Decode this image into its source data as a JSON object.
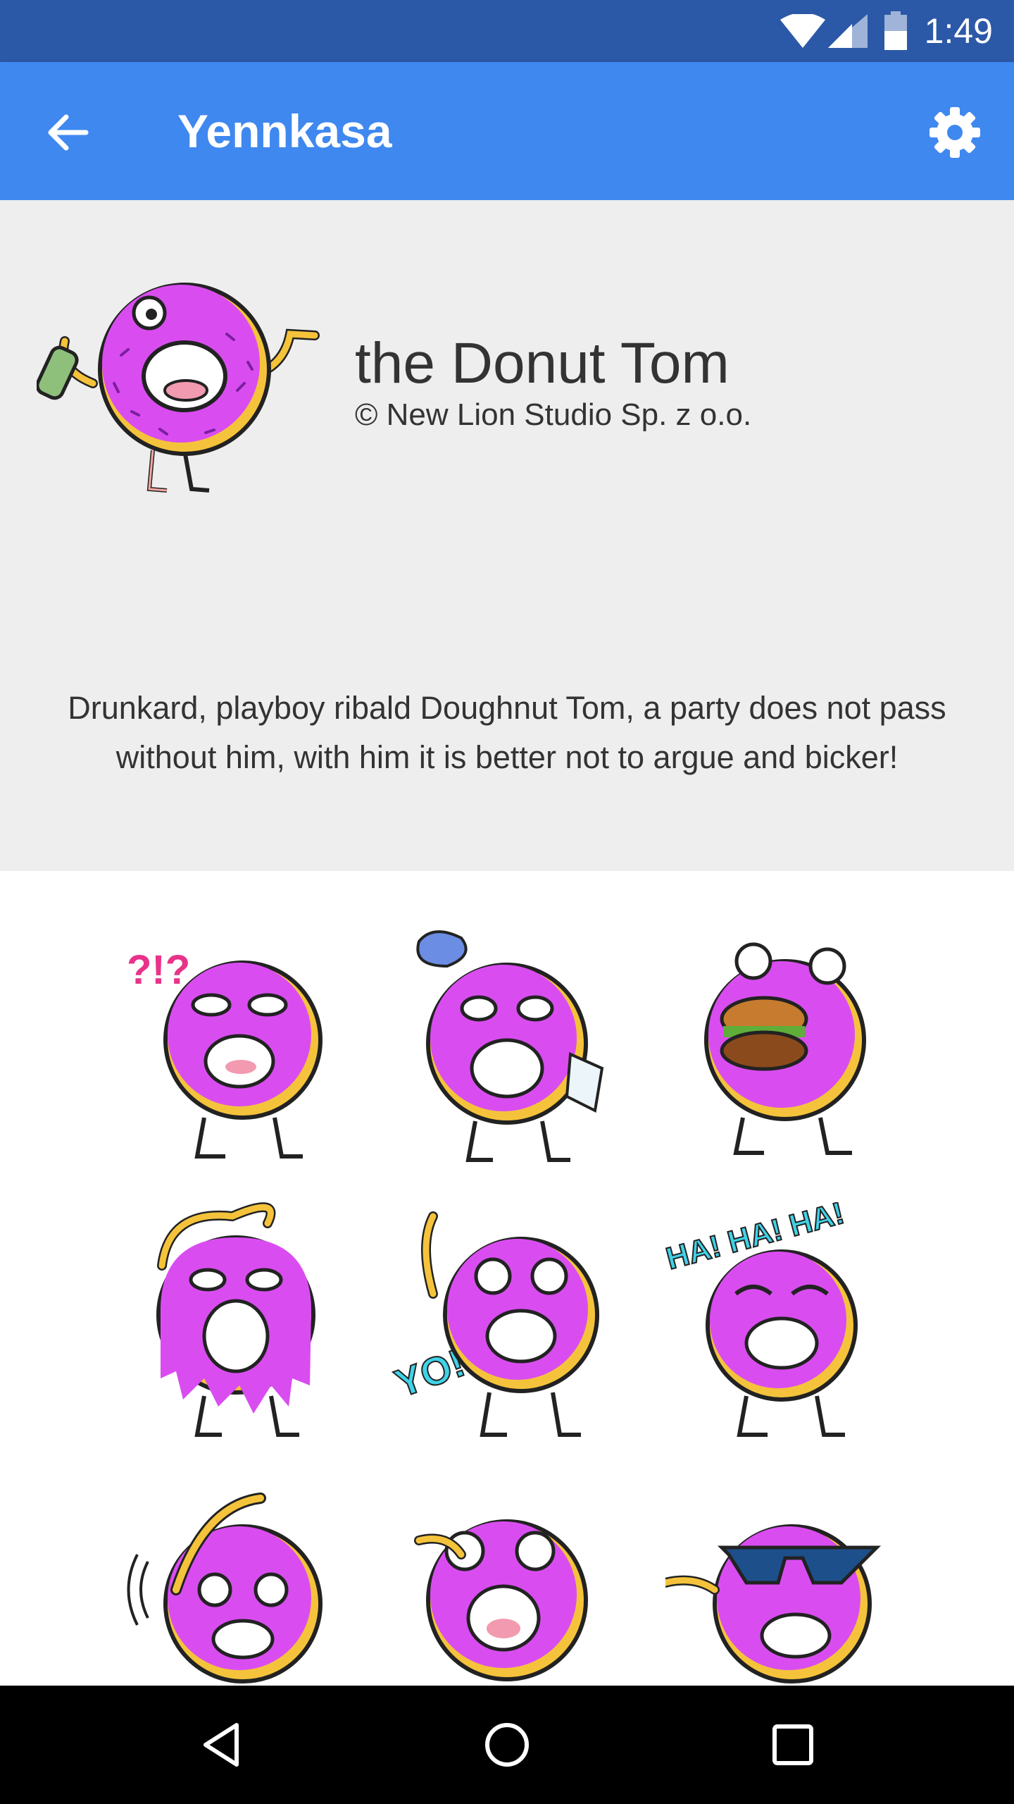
{
  "status_bar": {
    "time": "1:49"
  },
  "app_bar": {
    "title": "Yennkasa"
  },
  "pack": {
    "title": "the Donut Tom",
    "author": "© New Lion Studio Sp. z o.o.",
    "description": "Drunkard, playboy ribald Doughnut Tom, a party does not pass without him, with him it is better not to argue and bicker!"
  },
  "stickers": [
    {
      "name": "confused",
      "caption": "?!?"
    },
    {
      "name": "sweating"
    },
    {
      "name": "burger"
    },
    {
      "name": "melting"
    },
    {
      "name": "yo-hi",
      "caption": "YO! HI!"
    },
    {
      "name": "laughing",
      "caption": "HA! HA! HA!"
    },
    {
      "name": "facepalm"
    },
    {
      "name": "crying"
    },
    {
      "name": "sunglasses"
    }
  ],
  "colors": {
    "status_bar": "#2c58a8",
    "app_bar": "#3f88ef",
    "header_bg": "#eeeeee",
    "donut_icing": "#d94df0",
    "donut_dough": "#f5c33b"
  },
  "icons": [
    "wifi-icon",
    "signal-icon",
    "battery-icon",
    "back-arrow-icon",
    "settings-gear-icon",
    "nav-back-icon",
    "nav-home-icon",
    "nav-recents-icon"
  ]
}
